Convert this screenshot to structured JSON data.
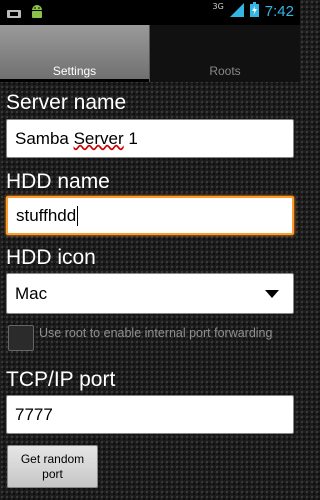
{
  "status_bar": {
    "time": "7:42",
    "network": "3G",
    "icons": [
      "usb-icon",
      "android-icon",
      "signal-icon",
      "battery-icon"
    ]
  },
  "tabs": [
    {
      "label": "Settings",
      "active": true
    },
    {
      "label": "Roots",
      "active": false
    }
  ],
  "server_name": {
    "label": "Server name",
    "value": "Samba Server 1"
  },
  "hdd_name": {
    "label": "HDD name",
    "value": "stuffhdd"
  },
  "hdd_icon": {
    "label": "HDD icon",
    "value": "Mac"
  },
  "root_option": {
    "label": "Use root to enable internal port forwarding",
    "checked": false
  },
  "tcp_port": {
    "label": "TCP/IP port",
    "value": "7777"
  },
  "random_port_button": {
    "label": "Get random port"
  },
  "colors": {
    "accent": "#33b5e5",
    "focus": "#ff9c2a"
  }
}
